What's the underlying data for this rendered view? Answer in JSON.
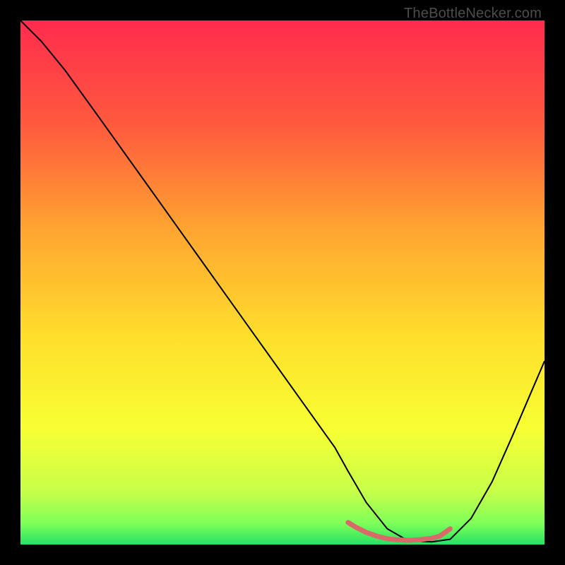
{
  "watermark": "TheBottleNecker.com",
  "chart_data": {
    "type": "line",
    "title": "",
    "xlabel": "",
    "ylabel": "",
    "xlim": [
      0,
      100
    ],
    "ylim": [
      0,
      100
    ],
    "grid": false,
    "gradient_stops": [
      {
        "offset": 0.0,
        "color": "#ff2b4e"
      },
      {
        "offset": 0.2,
        "color": "#ff5a3e"
      },
      {
        "offset": 0.4,
        "color": "#ffa531"
      },
      {
        "offset": 0.6,
        "color": "#ffde2c"
      },
      {
        "offset": 0.78,
        "color": "#f7ff33"
      },
      {
        "offset": 0.9,
        "color": "#c7ff49"
      },
      {
        "offset": 0.96,
        "color": "#7dff59"
      },
      {
        "offset": 1.0,
        "color": "#27e263"
      }
    ],
    "series": [
      {
        "name": "bottleneck-curve",
        "stroke": "#000000",
        "stroke_width": 2,
        "x": [
          0,
          4,
          8.5,
          15,
          25,
          35,
          45,
          55,
          60,
          62.5,
          66,
          70,
          74,
          78.5,
          82,
          86,
          90,
          94,
          97,
          100
        ],
        "y": [
          100,
          96,
          90.5,
          81.5,
          67.5,
          53.5,
          39.5,
          25.5,
          18.5,
          14,
          8,
          3,
          0.7,
          0.5,
          1,
          5,
          12,
          21,
          28,
          35
        ]
      },
      {
        "name": "sweet-spot-marker",
        "stroke": "#da6a6a",
        "stroke_width": 7,
        "linecap": "round",
        "x": [
          62.5,
          64,
          66,
          68,
          70,
          72,
          74,
          76,
          78.5,
          80,
          82
        ],
        "y": [
          4.2,
          3.3,
          2.3,
          1.6,
          1.1,
          0.9,
          0.8,
          0.9,
          1.2,
          1.6,
          3.0
        ]
      }
    ]
  }
}
